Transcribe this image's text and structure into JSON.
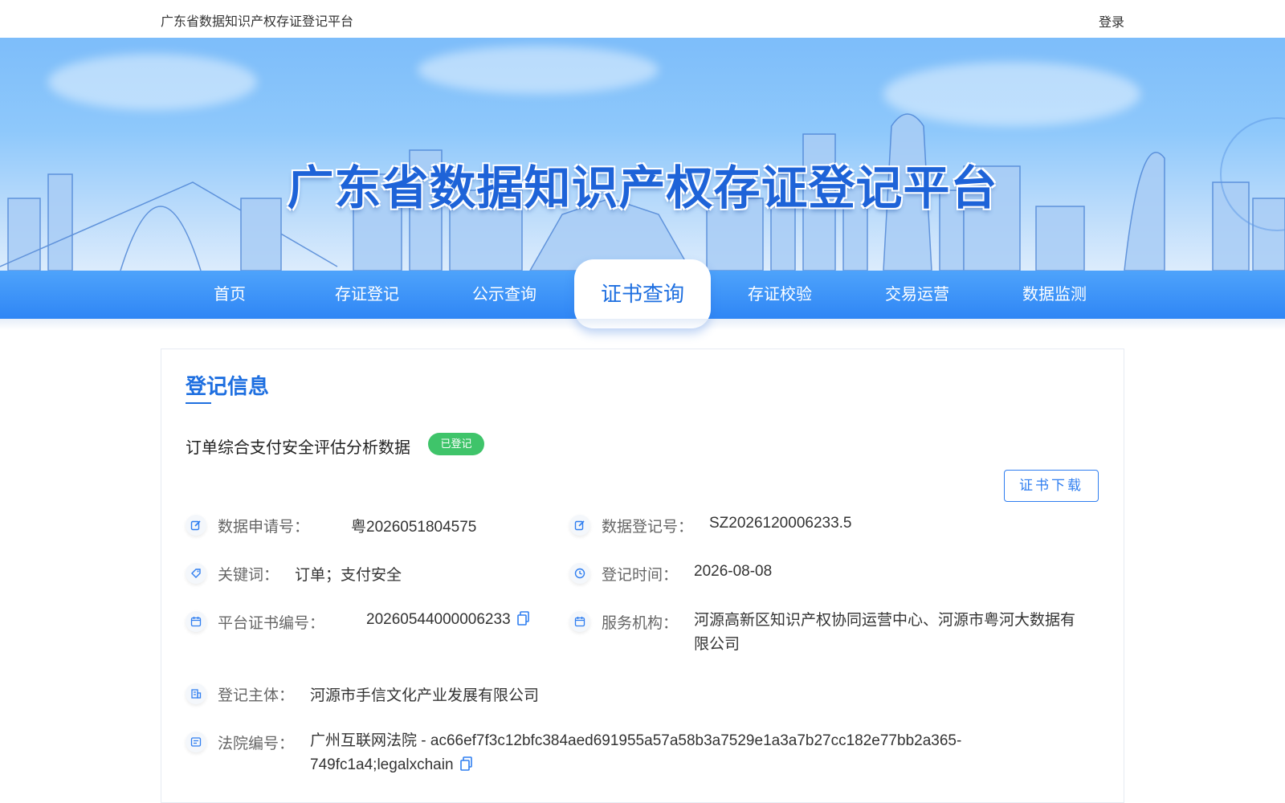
{
  "topbar": {
    "site_name": "广东省数据知识产权存证登记平台",
    "login": "登录"
  },
  "banner": {
    "headline": "广东省数据知识产权存证登记平台"
  },
  "nav": {
    "items": [
      "首页",
      "存证登记",
      "公示查询",
      "证书查询",
      "存证校验",
      "交易运营",
      "数据监测"
    ],
    "active": "证书查询"
  },
  "card": {
    "section_title": "登记信息",
    "record_title": "订单综合支付安全评估分析数据",
    "status_badge": "已登记",
    "download_button": "证书下载",
    "fields": {
      "application_no": {
        "label": "数据申请号：",
        "value": "粤2026051804575",
        "icon": "edit-icon"
      },
      "registration_no": {
        "label": "数据登记号：",
        "value": "SZ2026120006233.5",
        "icon": "edit-icon"
      },
      "keywords": {
        "label": "关键词：",
        "value": "订单；支付安全",
        "icon": "tag-icon"
      },
      "registration_time": {
        "label": "登记时间：",
        "value": "2026-08-08",
        "icon": "clock-icon"
      },
      "certificate_no": {
        "label": "平台证书编号：",
        "value": "20260544000006233",
        "icon": "calendar-icon"
      },
      "service_org": {
        "label": "服务机构：",
        "value_line1": "河源高新区知识产权协同运营中心、河源市粤河大数据有",
        "value_line2": "限公司",
        "icon": "calendar-icon"
      },
      "subject": {
        "label": "登记主体：",
        "value": "河源市手信文化产业发展有限公司",
        "icon": "building-icon"
      },
      "court_no": {
        "label": "法院编号：",
        "value_line1": "广州互联网法院 - ac66ef7f3c12bfc384aed691955a57a58b3a7529e1a3a7b27cc182e77bb2a365-",
        "value_line2": "749fc1a4;legalxchain",
        "icon": "id-card-icon"
      }
    }
  },
  "colors": {
    "primary": "#1e6fe0",
    "nav_blue": "#2f86f5",
    "badge_green": "#3fc46a"
  }
}
